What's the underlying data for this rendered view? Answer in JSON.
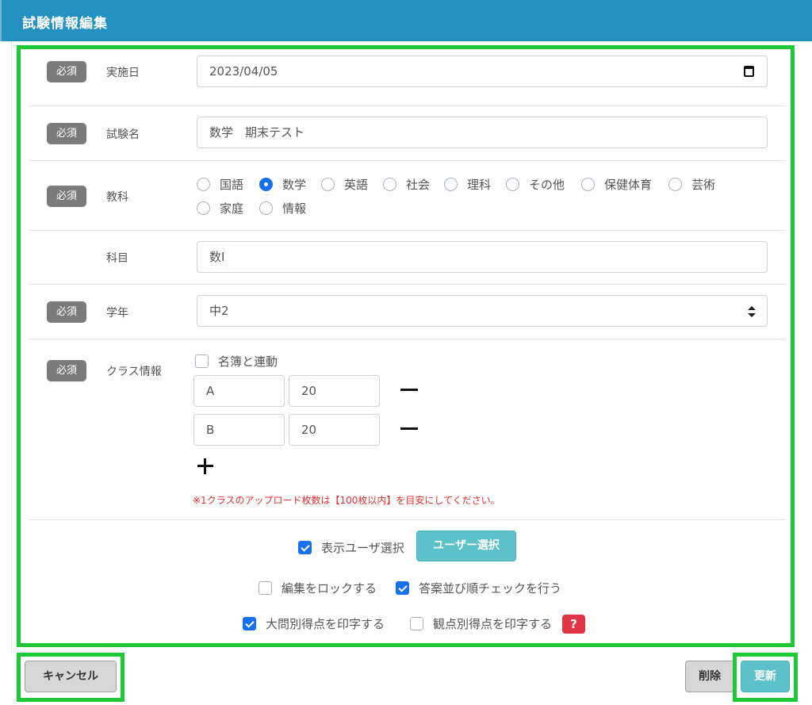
{
  "header": {
    "title": "試験情報編集"
  },
  "required_label": "必須",
  "date_row": {
    "label": "実施日",
    "value": "2023/04/05"
  },
  "name_row": {
    "label": "試験名",
    "value": "数学　期末テスト"
  },
  "subject_row": {
    "label": "教科",
    "options": [
      "国語",
      "数学",
      "英語",
      "社会",
      "理科",
      "その他",
      "保健体育",
      "芸術",
      "家庭",
      "情報"
    ],
    "selected": "数学"
  },
  "course_row": {
    "label": "科目",
    "value": "数Ⅰ"
  },
  "grade_row": {
    "label": "学年",
    "value": "中2"
  },
  "class_row": {
    "label": "クラス情報",
    "link_checkbox_label": "名簿と連動",
    "classes": [
      {
        "name": "A",
        "count": "20"
      },
      {
        "name": "B",
        "count": "20"
      }
    ],
    "note": "※1クラスのアップロード枚数は【100枚以内】を目安にしてください。"
  },
  "options": {
    "display_user_select": {
      "label": "表示ユーザ選択",
      "checked": true
    },
    "user_select_button": "ユーザー選択",
    "lock_edit": {
      "label": "編集をロックする",
      "checked": false
    },
    "answer_order_check": {
      "label": "答案並び順チェックを行う",
      "checked": true
    },
    "print_major_score": {
      "label": "大問別得点を印字する",
      "checked": true
    },
    "print_viewpoint_score": {
      "label": "観点別得点を印字する",
      "checked": false
    },
    "help_label": "?"
  },
  "footer": {
    "cancel_label": "キャンセル",
    "delete_label": "削除",
    "update_label": "更新"
  },
  "colors": {
    "header": "#2591c1",
    "highlight": "#1ec837",
    "teal": "#5cc1c9",
    "error": "#e03030",
    "primary": "#1670f0"
  }
}
